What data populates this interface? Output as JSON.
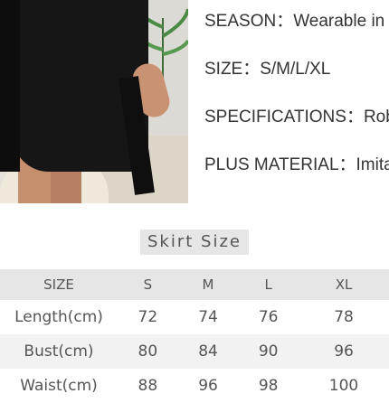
{
  "photo": {
    "icon": "product-photo"
  },
  "specs": [
    {
      "label": "SEASON：Wearable in"
    },
    {
      "label": "SIZE：S/M/L/XL"
    },
    {
      "label": "SPECIFICATIONS：Rob"
    },
    {
      "label": "PLUS MATERIAL：Imita"
    }
  ],
  "size_title": "Skirt Size",
  "table": {
    "headers": [
      "SIZE",
      "S",
      "M",
      "L",
      "XL"
    ],
    "rows": [
      {
        "label": "Length(cm)",
        "values": [
          "72",
          "74",
          "76",
          "78"
        ]
      },
      {
        "label": "Bust(cm)",
        "values": [
          "80",
          "84",
          "90",
          "96"
        ]
      },
      {
        "label": "Waist(cm)",
        "values": [
          "88",
          "96",
          "98",
          "100"
        ]
      }
    ]
  }
}
